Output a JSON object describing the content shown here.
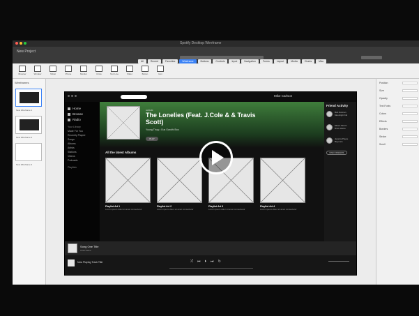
{
  "window": {
    "title": "Spotify Desktop Wireframe"
  },
  "toolbar": {
    "left_label": "New Project",
    "right_label": ""
  },
  "tabs": [
    "All",
    "Recent",
    "Favorites",
    "Wireframe",
    "Buttons",
    "Controls",
    "Input",
    "Navigation",
    "Forms",
    "Layout",
    "Media",
    "Charts",
    "Misc"
  ],
  "components": [
    "Browser",
    "Window",
    "Tablet",
    "Phone",
    "Monitor",
    "Circle",
    "Text Line",
    "Slider",
    "Button",
    "Icon"
  ],
  "leftbar": {
    "header": "Wireframes",
    "thumbs": [
      "New Wireframe 1",
      "New Wireframe 2",
      "New Wireframe 3"
    ]
  },
  "inspector": {
    "rows": [
      "Position",
      "Size",
      "Opacity",
      "Text Fonts",
      "Colors",
      "Effects",
      "Borders",
      "Stroke",
      "Scroll"
    ]
  },
  "app": {
    "nav": [
      "Home",
      "Browse",
      "Radio"
    ],
    "section": "Your Library",
    "library": [
      "Made For You",
      "Recently Played",
      "Songs",
      "Albums",
      "Artists",
      "Stations",
      "Videos",
      "Podcasts"
    ],
    "playlists_h": "Playlists",
    "user": "Mike Carlson",
    "hero": {
      "kind": "ALBUM",
      "title": "The Lonelies (Feat. J.Cole & & Travis Scott)",
      "meta": "Young Thug • Gus Gandhi Boo",
      "play": "PLAY"
    },
    "albums_header": "All the latest Albums",
    "albums": [
      {
        "name": "Playlist Art 1",
        "desc": "Lorem ipsum dolor sit amet consectetur"
      },
      {
        "name": "Playlist Art 2",
        "desc": "Lorem ipsum dolor sit amet consectetur"
      },
      {
        "name": "Playlist Art 3",
        "desc": "Lorem ipsum dolor sit amet consectetur"
      },
      {
        "name": "Playlist Art 4",
        "desc": "Lorem ipsum dolor sit amet consectetur"
      }
    ],
    "friends": {
      "header": "Friend Activity",
      "list": [
        {
          "name": "Bob Dolman",
          "track": "Moonlight Kid"
        },
        {
          "name": "Eileen Morris",
          "track": "Drive Home"
        },
        {
          "name": "Jessica Payne",
          "track": "Beyonce"
        }
      ],
      "button": "FIND FRIENDS"
    },
    "nowbar": {
      "title": "Song One Title",
      "artist": "Artist Name"
    },
    "player": {
      "track": "Now Playing Track Title",
      "controls": [
        "⤮",
        "⏮",
        "⏵",
        "⏭",
        "↻"
      ]
    }
  },
  "overlay": {
    "label": "play-video"
  }
}
